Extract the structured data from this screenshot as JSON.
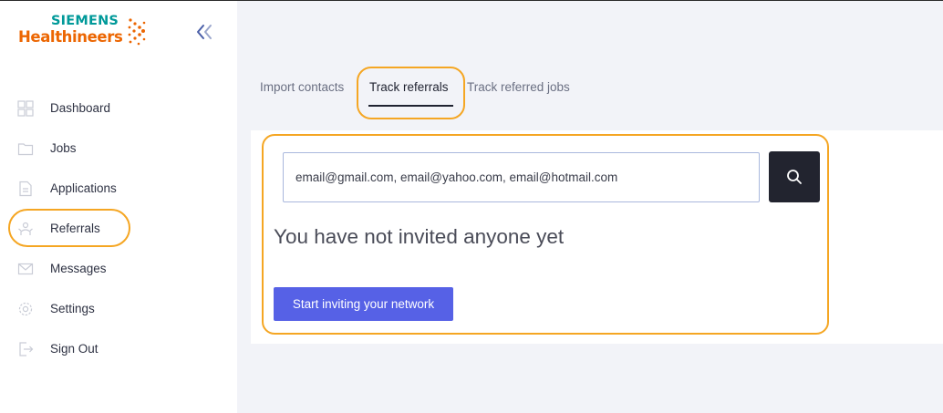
{
  "brand": {
    "company": "SIEMENS",
    "product": "Healthineers",
    "colors": {
      "teal": "#009999",
      "orange": "#ec6602"
    }
  },
  "sidebar": {
    "collapse_icon": "double-chevron-left-icon",
    "items": [
      {
        "label": "Dashboard",
        "icon": "grid-icon"
      },
      {
        "label": "Jobs",
        "icon": "folder-icon"
      },
      {
        "label": "Applications",
        "icon": "document-icon"
      },
      {
        "label": "Referrals",
        "icon": "referral-icon"
      },
      {
        "label": "Messages",
        "icon": "envelope-icon"
      },
      {
        "label": "Settings",
        "icon": "gear-icon"
      },
      {
        "label": "Sign Out",
        "icon": "sign-out-icon"
      }
    ]
  },
  "tabs": [
    {
      "label": "Import contacts",
      "active": false
    },
    {
      "label": "Track referrals",
      "active": true
    },
    {
      "label": "Track referred jobs",
      "active": false
    }
  ],
  "main": {
    "search": {
      "placeholder": "email@gmail.com, email@yahoo.com, email@hotmail.com",
      "button_icon": "search-icon"
    },
    "empty_title": "You have not invited anyone yet",
    "invite_button": "Start inviting your network"
  },
  "colors": {
    "highlight": "#f5a623",
    "accent_button": "#5661e6",
    "dark_button": "#22242f"
  }
}
